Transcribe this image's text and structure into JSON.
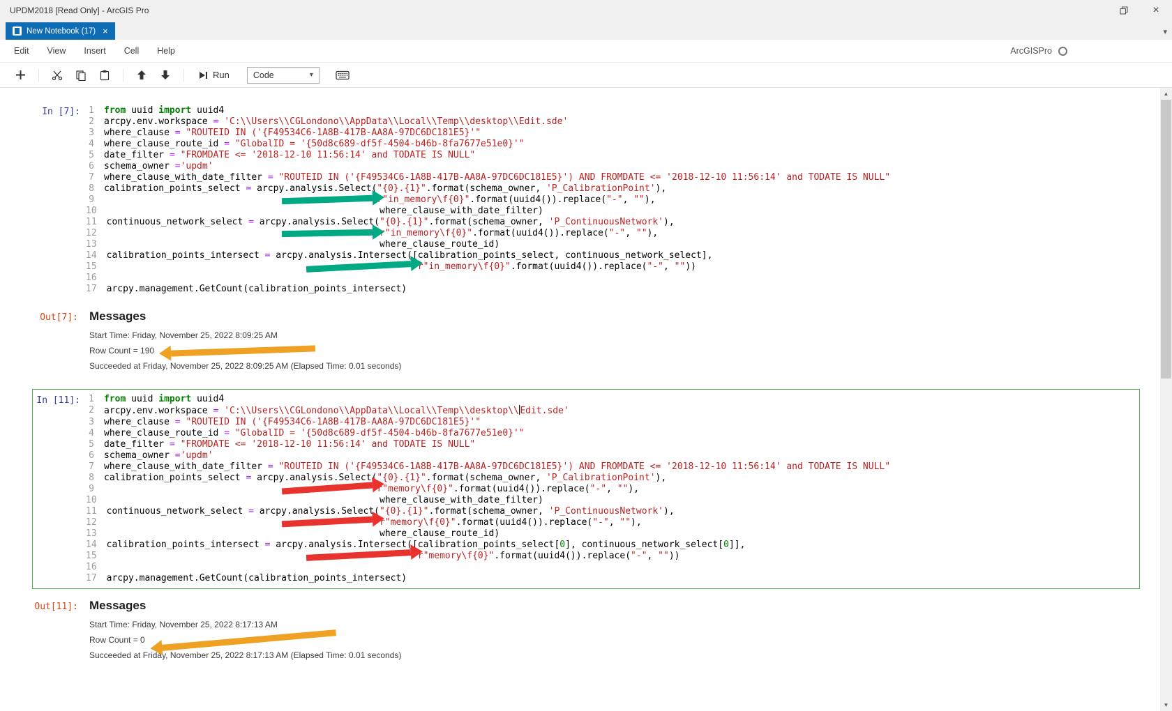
{
  "window": {
    "title": "UPDM2018 [Read Only] - ArcGIS Pro"
  },
  "tabs": {
    "active": {
      "label": "New Notebook (17)"
    }
  },
  "menu": {
    "items": [
      "Edit",
      "View",
      "Insert",
      "Cell",
      "Help"
    ],
    "kernel_name": "ArcGISPro"
  },
  "toolbar": {
    "run_label": "Run",
    "cell_type_value": "Code"
  },
  "colors": {
    "tab-blue": "#0e6cb5",
    "teal": "#00a884",
    "red": "#e8322e",
    "orange": "#efa123",
    "cell-selected": "#4caf50",
    "in-prompt": "#303f9f",
    "out-prompt": "#d84315",
    "tok-k": "#008000",
    "tok-s": "#ba2121",
    "tok-o": "#aa22ff",
    "tok-d": "#008000"
  },
  "cells": [
    {
      "in_label": "In [7]:",
      "out_label": "Out[7]:",
      "code_lines": [
        [
          [
            "k",
            "from"
          ],
          [
            "p",
            " uuid "
          ],
          [
            "k",
            "import"
          ],
          [
            "p",
            " uuid4"
          ]
        ],
        [
          [
            "p",
            "arcpy.env.workspace "
          ],
          [
            "o",
            "="
          ],
          [
            "p",
            " "
          ],
          [
            "s",
            "'C:\\\\Users\\\\CGLondono\\\\AppData\\\\Local\\\\Temp\\\\desktop\\\\Edit.sde'"
          ]
        ],
        [
          [
            "p",
            "where_clause "
          ],
          [
            "o",
            "="
          ],
          [
            "p",
            " "
          ],
          [
            "s",
            "\"ROUTEID IN ('{F49534C6-1A8B-417B-AA8A-97DC6DC181E5}'\""
          ]
        ],
        [
          [
            "p",
            "where_clause_route_id "
          ],
          [
            "o",
            "="
          ],
          [
            "p",
            " "
          ],
          [
            "s",
            "\"GlobalID = '{50d8c689-df5f-4504-b46b-8fa7677e51e0}'\""
          ]
        ],
        [
          [
            "p",
            "date_filter "
          ],
          [
            "o",
            "="
          ],
          [
            "p",
            " "
          ],
          [
            "s",
            "\"FROMDATE <= '2018-12-10 11:56:14' and TODATE IS NULL\""
          ]
        ],
        [
          [
            "p",
            "schema_owner "
          ],
          [
            "o",
            "="
          ],
          [
            "s",
            "'updm'"
          ]
        ],
        [
          [
            "p",
            "where_clause_with_date_filter "
          ],
          [
            "o",
            "="
          ],
          [
            "p",
            " "
          ],
          [
            "s",
            "\"ROUTEID IN ('{F49534C6-1A8B-417B-AA8A-97DC6DC181E5}') AND FROMDATE <= '2018-12-10 11:56:14' and TODATE IS NULL\""
          ]
        ],
        [
          [
            "p",
            "calibration_points_select "
          ],
          [
            "o",
            "="
          ],
          [
            "p",
            " arcpy.analysis.Select("
          ],
          [
            "s",
            "\"{0}.{1}\""
          ],
          [
            "p",
            ".format(schema_owner, "
          ],
          [
            "s",
            "'P_CalibrationPoint'"
          ],
          [
            "p",
            "),"
          ]
        ],
        [
          [
            "p",
            "                                                  "
          ],
          [
            "s",
            "r\"in_memory\\f{0}\""
          ],
          [
            "p",
            ".format(uuid4()).replace("
          ],
          [
            "s",
            "\"-\""
          ],
          [
            "p",
            ", "
          ],
          [
            "s",
            "\"\""
          ],
          [
            "p",
            "),"
          ]
        ],
        [
          [
            "p",
            "                                                  where_clause_with_date_filter)"
          ]
        ],
        [
          [
            "p",
            "continuous_network_select "
          ],
          [
            "o",
            "="
          ],
          [
            "p",
            " arcpy.analysis.Select("
          ],
          [
            "s",
            "\"{0}.{1}\""
          ],
          [
            "p",
            ".format(schema_owner, "
          ],
          [
            "s",
            "'P_ContinuousNetwork'"
          ],
          [
            "p",
            "),"
          ]
        ],
        [
          [
            "p",
            "                                                  "
          ],
          [
            "s",
            "r\"in_memory\\f{0}\""
          ],
          [
            "p",
            ".format(uuid4()).replace("
          ],
          [
            "s",
            "\"-\""
          ],
          [
            "p",
            ", "
          ],
          [
            "s",
            "\"\""
          ],
          [
            "p",
            "),"
          ]
        ],
        [
          [
            "p",
            "                                                  where_clause_route_id)"
          ]
        ],
        [
          [
            "p",
            "calibration_points_intersect "
          ],
          [
            "o",
            "="
          ],
          [
            "p",
            " arcpy.analysis.Intersect([calibration_points_select, continuous_network_select],"
          ]
        ],
        [
          [
            "p",
            "                                                         "
          ],
          [
            "s",
            "r\"in_memory\\f{0}\""
          ],
          [
            "p",
            ".format(uuid4()).replace("
          ],
          [
            "s",
            "\"-\""
          ],
          [
            "p",
            ", "
          ],
          [
            "s",
            "\"\""
          ],
          [
            "p",
            "))"
          ]
        ],
        [],
        [
          [
            "p",
            "arcpy.management.GetCount(calibration_points_intersect)"
          ]
        ]
      ],
      "output": {
        "heading": "Messages",
        "start_time": "Start Time: Friday, November 25, 2022 8:09:25 AM",
        "row_count": "Row Count = 190",
        "succeeded": "Succeeded at Friday, November 25, 2022 8:09:25 AM (Elapsed Time: 0.01 seconds)"
      }
    },
    {
      "in_label": "In [11]:",
      "out_label": "Out[11]:",
      "code_lines": [
        [
          [
            "k",
            "from"
          ],
          [
            "p",
            " uuid "
          ],
          [
            "k",
            "import"
          ],
          [
            "p",
            " uuid4"
          ]
        ],
        [
          [
            "p",
            "arcpy.env.workspace "
          ],
          [
            "o",
            "="
          ],
          [
            "p",
            " "
          ],
          [
            "s",
            "'C:\\\\Users\\\\CGLondono\\\\AppData\\\\Local\\\\Temp\\\\desktop\\\\"
          ],
          [
            "c",
            ""
          ],
          [
            "s",
            "Edit.sde'"
          ]
        ],
        [
          [
            "p",
            "where_clause "
          ],
          [
            "o",
            "="
          ],
          [
            "p",
            " "
          ],
          [
            "s",
            "\"ROUTEID IN ('{F49534C6-1A8B-417B-AA8A-97DC6DC181E5}'\""
          ]
        ],
        [
          [
            "p",
            "where_clause_route_id "
          ],
          [
            "o",
            "="
          ],
          [
            "p",
            " "
          ],
          [
            "s",
            "\"GlobalID = '{50d8c689-df5f-4504-b46b-8fa7677e51e0}'\""
          ]
        ],
        [
          [
            "p",
            "date_filter "
          ],
          [
            "o",
            "="
          ],
          [
            "p",
            " "
          ],
          [
            "s",
            "\"FROMDATE <= '2018-12-10 11:56:14' and TODATE IS NULL\""
          ]
        ],
        [
          [
            "p",
            "schema_owner "
          ],
          [
            "o",
            "="
          ],
          [
            "s",
            "'updm'"
          ]
        ],
        [
          [
            "p",
            "where_clause_with_date_filter "
          ],
          [
            "o",
            "="
          ],
          [
            "p",
            " "
          ],
          [
            "s",
            "\"ROUTEID IN ('{F49534C6-1A8B-417B-AA8A-97DC6DC181E5}') AND FROMDATE <= '2018-12-10 11:56:14' and TODATE IS NULL\""
          ]
        ],
        [
          [
            "p",
            "calibration_points_select "
          ],
          [
            "o",
            "="
          ],
          [
            "p",
            " arcpy.analysis.Select("
          ],
          [
            "s",
            "\"{0}.{1}\""
          ],
          [
            "p",
            ".format(schema_owner, "
          ],
          [
            "s",
            "'P_CalibrationPoint'"
          ],
          [
            "p",
            "),"
          ]
        ],
        [
          [
            "p",
            "                                                  "
          ],
          [
            "s",
            "r\"memory\\f{0}\""
          ],
          [
            "p",
            ".format(uuid4()).replace("
          ],
          [
            "s",
            "\"-\""
          ],
          [
            "p",
            ", "
          ],
          [
            "s",
            "\"\""
          ],
          [
            "p",
            "),"
          ]
        ],
        [
          [
            "p",
            "                                                  where_clause_with_date_filter)"
          ]
        ],
        [
          [
            "p",
            "continuous_network_select "
          ],
          [
            "o",
            "="
          ],
          [
            "p",
            " arcpy.analysis.Select("
          ],
          [
            "s",
            "\"{0}.{1}\""
          ],
          [
            "p",
            ".format(schema_owner, "
          ],
          [
            "s",
            "'P_ContinuousNetwork'"
          ],
          [
            "p",
            "),"
          ]
        ],
        [
          [
            "p",
            "                                                  "
          ],
          [
            "s",
            "r\"memory\\f{0}\""
          ],
          [
            "p",
            ".format(uuid4()).replace("
          ],
          [
            "s",
            "\"-\""
          ],
          [
            "p",
            ", "
          ],
          [
            "s",
            "\"\""
          ],
          [
            "p",
            "),"
          ]
        ],
        [
          [
            "p",
            "                                                  where_clause_route_id)"
          ]
        ],
        [
          [
            "p",
            "calibration_points_intersect "
          ],
          [
            "o",
            "="
          ],
          [
            "p",
            " arcpy.analysis.Intersect([calibration_points_select["
          ],
          [
            "d",
            "0"
          ],
          [
            "p",
            "], continuous_network_select["
          ],
          [
            "d",
            "0"
          ],
          [
            "p",
            "]],"
          ]
        ],
        [
          [
            "p",
            "                                                         "
          ],
          [
            "s",
            "r\"memory\\f{0}\""
          ],
          [
            "p",
            ".format(uuid4()).replace("
          ],
          [
            "s",
            "\"-\""
          ],
          [
            "p",
            ", "
          ],
          [
            "s",
            "\"\""
          ],
          [
            "p",
            "))"
          ]
        ],
        [],
        [
          [
            "p",
            "arcpy.management.GetCount(calibration_points_intersect)"
          ]
        ]
      ],
      "output": {
        "heading": "Messages",
        "start_time": "Start Time: Friday, November 25, 2022 8:17:13 AM",
        "row_count": "Row Count = 0",
        "succeeded": "Succeeded at Friday, November 25, 2022 8:17:13 AM (Elapsed Time: 0.01 seconds)"
      }
    }
  ]
}
